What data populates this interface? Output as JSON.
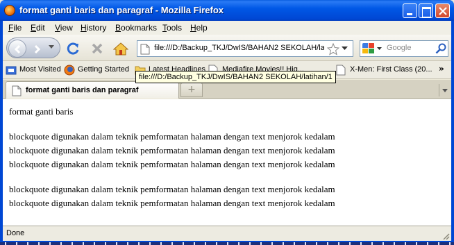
{
  "window": {
    "title": "format ganti baris dan paragraf - Mozilla Firefox"
  },
  "menu": [
    "File",
    "Edit",
    "View",
    "History",
    "Bookmarks",
    "Tools",
    "Help"
  ],
  "nav": {
    "url": "file:///D:/Backup_TKJ/DwIS/BAHAN2 SEKOLAH/latihan/1",
    "search_placeholder": "Google"
  },
  "bookmarks": [
    {
      "label": "Most Visited",
      "icon": "bookmarks-folder-icon"
    },
    {
      "label": "Getting Started",
      "icon": "firefox-icon"
    },
    {
      "label": "Latest Headlines",
      "icon": "rss-folder-icon"
    },
    {
      "label": "Mediafire Movies!! Hig...",
      "icon": "page-icon"
    },
    {
      "label": "X-Men: First Class (20...",
      "icon": "page-icon"
    }
  ],
  "tooltip": "file:///D:/Backup_TKJ/DwIS/BAHAN2 SEKOLAH/latihan/1",
  "tab": {
    "title": "format ganti baris dan paragraf"
  },
  "content": {
    "lines": [
      "format ganti baris",
      "blockquote digunakan dalam teknik pemformatan halaman dengan text menjorok kedalam",
      "blockquote digunakan dalam teknik pemformatan halaman dengan text menjorok kedalam",
      "blockquote digunakan dalam teknik pemformatan halaman dengan text menjorok kedalam",
      "blockquote digunakan dalam teknik pemformatan halaman dengan text menjorok kedalam",
      "blockquote digunakan dalam teknik pemformatan halaman dengan text menjorok kedalam"
    ]
  },
  "status": "Done"
}
